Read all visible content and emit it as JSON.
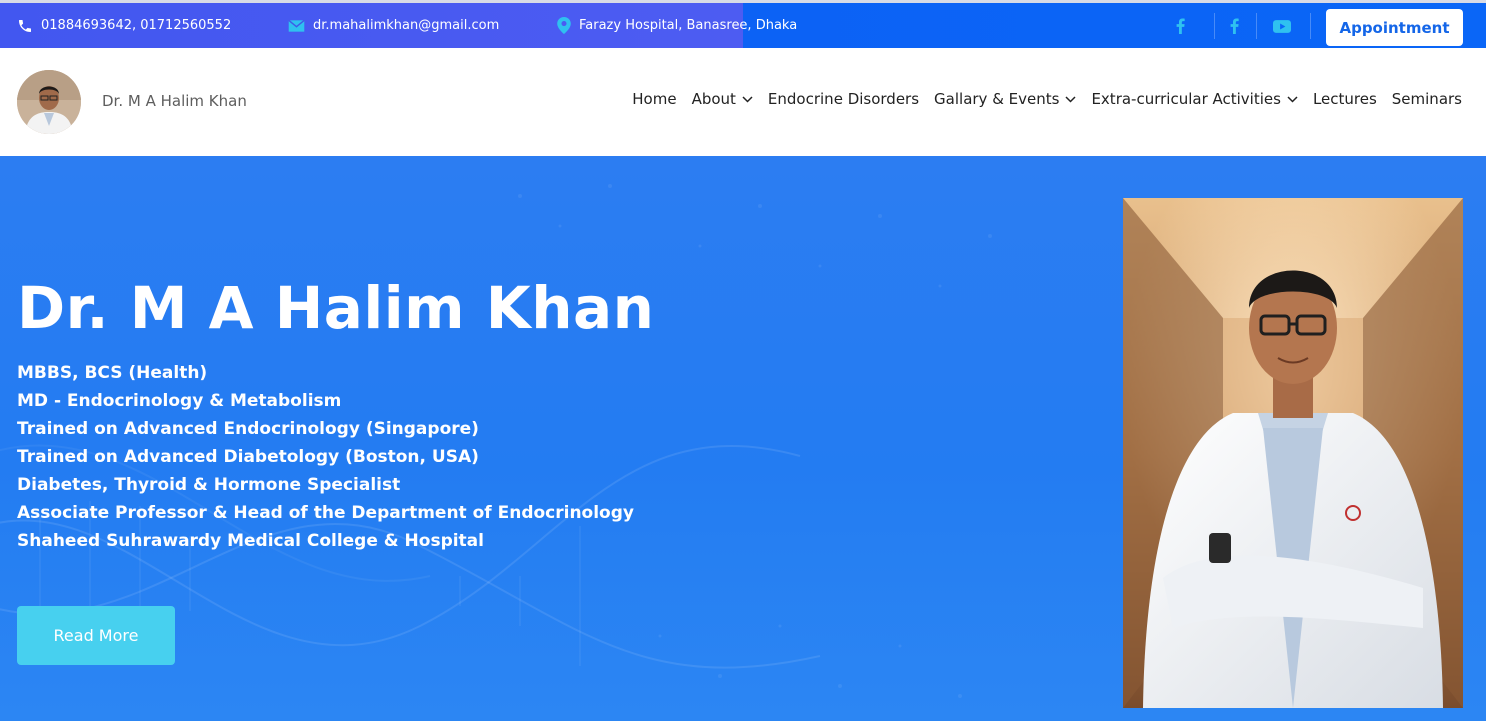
{
  "topbar": {
    "phone": "01884693642, 01712560552",
    "email": "dr.mahalimkhan@gmail.com",
    "location": "Farazy Hospital, Banasree, Dhaka",
    "social_icons": [
      "facebook-icon",
      "facebook-icon",
      "youtube-icon"
    ],
    "appointment_label": "Appointment"
  },
  "header": {
    "site_name": "Dr. M A Halim Khan",
    "nav": [
      {
        "label": "Home",
        "has_dropdown": false
      },
      {
        "label": "About",
        "has_dropdown": true
      },
      {
        "label": "Endocrine Disorders",
        "has_dropdown": false
      },
      {
        "label": "Gallary & Events",
        "has_dropdown": true
      },
      {
        "label": "Extra-curricular Activities",
        "has_dropdown": true
      },
      {
        "label": "Lectures",
        "has_dropdown": false
      },
      {
        "label": "Seminars",
        "has_dropdown": false
      }
    ]
  },
  "hero": {
    "title": "Dr. M A Halim Khan",
    "credentials": [
      "MBBS, BCS (Health)",
      "MD - Endocrinology & Metabolism",
      "Trained on Advanced Endocrinology (Singapore)",
      "Trained on Advanced Diabetology (Boston, USA)",
      "Diabetes, Thyroid & Hormone Specialist",
      "Associate Professor & Head of the Department of Endocrinology",
      "Shaheed Suhrawardy Medical College & Hospital"
    ],
    "read_more_label": "Read More"
  },
  "colors": {
    "topbar_left": "#4257f0",
    "topbar_right": "#0a66f7",
    "hero_blue": "#237cf2",
    "accent_cyan": "#47d0ef",
    "social_icon": "#2fc1f0",
    "appointment_text": "#1466e8"
  }
}
